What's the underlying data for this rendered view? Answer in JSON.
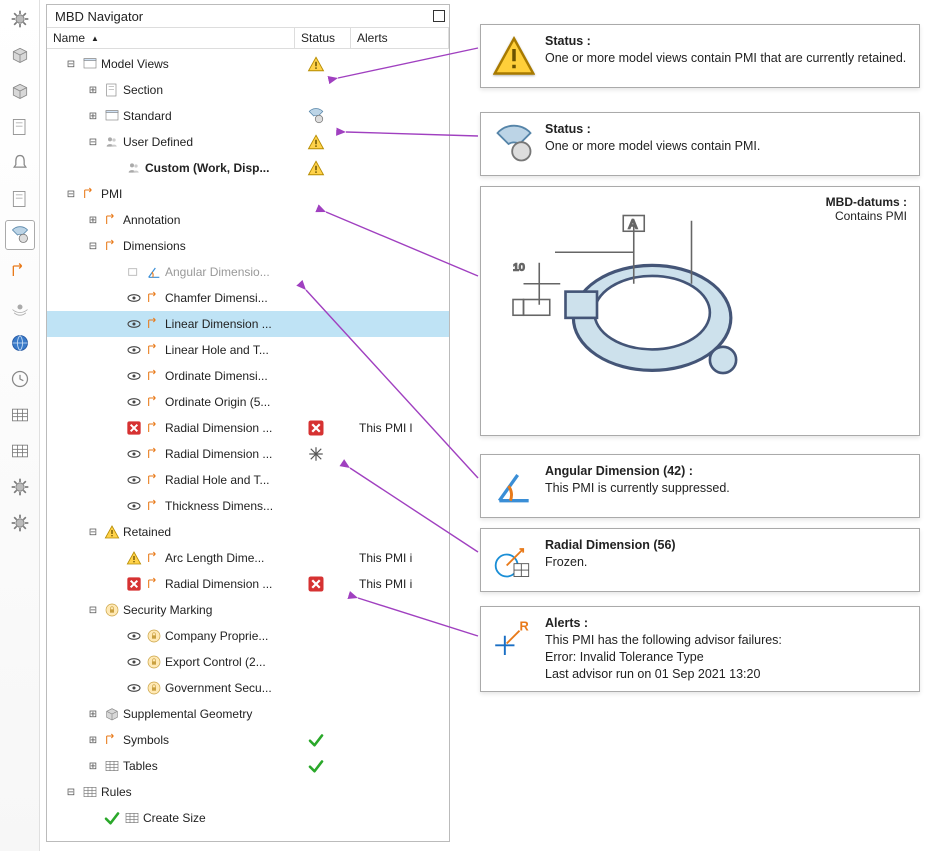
{
  "iconbar": [
    {
      "name": "gear-icon"
    },
    {
      "name": "cube-icon"
    },
    {
      "name": "part-icon",
      "active": false
    },
    {
      "name": "sheet-icon"
    },
    {
      "name": "bell-icon"
    },
    {
      "name": "stack-icon"
    },
    {
      "name": "mbd-icon",
      "active": true
    },
    {
      "name": "inspect-icon"
    },
    {
      "name": "signal-icon"
    },
    {
      "name": "globe-icon"
    },
    {
      "name": "clock-icon"
    },
    {
      "name": "color-icon"
    },
    {
      "name": "chart-icon"
    },
    {
      "name": "tools-icon"
    },
    {
      "name": "settings-icon"
    }
  ],
  "panel": {
    "title": "MBD Navigator",
    "columns": {
      "name": "Name",
      "status": "Status",
      "alerts": "Alerts"
    }
  },
  "tree": [
    {
      "id": "mv",
      "lvl": 0,
      "exp": "-",
      "icon": "views",
      "label": "Model Views",
      "status": "warn"
    },
    {
      "id": "sec",
      "lvl": 1,
      "exp": "+",
      "icon": "sheet",
      "label": "Section"
    },
    {
      "id": "std",
      "lvl": 1,
      "exp": "+",
      "icon": "std",
      "label": "Standard",
      "status": "gear"
    },
    {
      "id": "ud",
      "lvl": 1,
      "exp": "-",
      "icon": "user",
      "label": "User Defined",
      "status": "warn"
    },
    {
      "id": "cw",
      "lvl": 2,
      "exp": "",
      "icon": "userb",
      "label": "Custom (Work, Disp...",
      "bold": true,
      "status": "warn"
    },
    {
      "id": "pmi",
      "lvl": 0,
      "exp": "-",
      "icon": "pmi",
      "label": "PMI"
    },
    {
      "id": "ann",
      "lvl": 1,
      "exp": "+",
      "icon": "ann",
      "label": "Annotation"
    },
    {
      "id": "dim",
      "lvl": 1,
      "exp": "-",
      "icon": "dim",
      "label": "Dimensions"
    },
    {
      "id": "ang",
      "lvl": 2,
      "exp": "",
      "eye": "dim",
      "icon": "angdim",
      "label": "Angular Dimensio...",
      "grayed": true
    },
    {
      "id": "chf",
      "lvl": 2,
      "exp": "",
      "eye": "on",
      "icon": "chfdim",
      "label": "Chamfer Dimensi..."
    },
    {
      "id": "lin",
      "lvl": 2,
      "exp": "",
      "eye": "on",
      "icon": "lindim",
      "label": "Linear Dimension ...",
      "selected": true
    },
    {
      "id": "lht",
      "lvl": 2,
      "exp": "",
      "eye": "on",
      "icon": "lht",
      "label": "Linear Hole and T..."
    },
    {
      "id": "ord",
      "lvl": 2,
      "exp": "",
      "eye": "on",
      "icon": "ord",
      "label": "Ordinate Dimensi..."
    },
    {
      "id": "oro",
      "lvl": 2,
      "exp": "",
      "eye": "on",
      "icon": "oro",
      "label": "Ordinate Origin (5..."
    },
    {
      "id": "rad1",
      "lvl": 2,
      "exp": "",
      "eye": "err",
      "icon": "raddim",
      "label": "Radial Dimension ...",
      "status": "err",
      "alert": "This PMI l"
    },
    {
      "id": "rad2",
      "lvl": 2,
      "exp": "",
      "eye": "on",
      "icon": "raddim2",
      "label": "Radial Dimension ...",
      "status": "freeze"
    },
    {
      "id": "rht",
      "lvl": 2,
      "exp": "",
      "eye": "on",
      "icon": "rht",
      "label": "Radial Hole and T..."
    },
    {
      "id": "thk",
      "lvl": 2,
      "exp": "",
      "eye": "on",
      "icon": "thk",
      "label": "Thickness Dimens..."
    },
    {
      "id": "ret",
      "lvl": 1,
      "exp": "-",
      "icon": "retwarn",
      "label": "Retained",
      "status": ""
    },
    {
      "id": "arc",
      "lvl": 2,
      "exp": "",
      "eye": "warn",
      "icon": "arcdim",
      "label": "Arc Length Dime...",
      "alert": "This PMI i"
    },
    {
      "id": "rad3",
      "lvl": 2,
      "exp": "",
      "eye": "err",
      "icon": "raddim3",
      "label": "Radial Dimension ...",
      "status": "err",
      "alert": "This PMI i"
    },
    {
      "id": "sm",
      "lvl": 1,
      "exp": "-",
      "icon": "sec",
      "label": "Security Marking"
    },
    {
      "id": "cp",
      "lvl": 2,
      "exp": "",
      "eye": "on",
      "icon": "smk",
      "label": "Company Proprie..."
    },
    {
      "id": "ec",
      "lvl": 2,
      "exp": "",
      "eye": "on",
      "icon": "smk",
      "label": "Export Control (2..."
    },
    {
      "id": "gs",
      "lvl": 2,
      "exp": "",
      "eye": "on",
      "icon": "smk",
      "label": "Government Secu..."
    },
    {
      "id": "sg",
      "lvl": 1,
      "exp": "+",
      "icon": "sg",
      "label": "Supplemental Geometry"
    },
    {
      "id": "sym",
      "lvl": 1,
      "exp": "+",
      "icon": "sym",
      "label": "Symbols",
      "status": "ok"
    },
    {
      "id": "tbl",
      "lvl": 1,
      "exp": "+",
      "icon": "tbl",
      "label": "Tables",
      "status": "ok"
    },
    {
      "id": "rules",
      "lvl": 0,
      "exp": "-",
      "icon": "rules",
      "label": "Rules"
    },
    {
      "id": "cs",
      "lvl": 1,
      "exp": "",
      "icon": "rule",
      "label": "Create Size",
      "pre": "ok"
    }
  ],
  "callouts": {
    "c1": {
      "title": "Status :",
      "body": "One or more model views contain PMI that are currently retained."
    },
    "c2": {
      "title": "Status :",
      "body": "One or more model views contain PMI."
    },
    "c3": {
      "title": "MBD-datums :",
      "body": "Contains PMI"
    },
    "c4": {
      "title": "Angular Dimension (42) :",
      "body": "This PMI is currently suppressed."
    },
    "c5": {
      "title": "Radial Dimension (56)",
      "body": "Frozen."
    },
    "c6": {
      "title": "Alerts :",
      "lines": [
        "This PMI has the following advisor failures:",
        "Error: Invalid Tolerance Type",
        "Last advisor run on 01 Sep 2021 13:20"
      ]
    }
  }
}
